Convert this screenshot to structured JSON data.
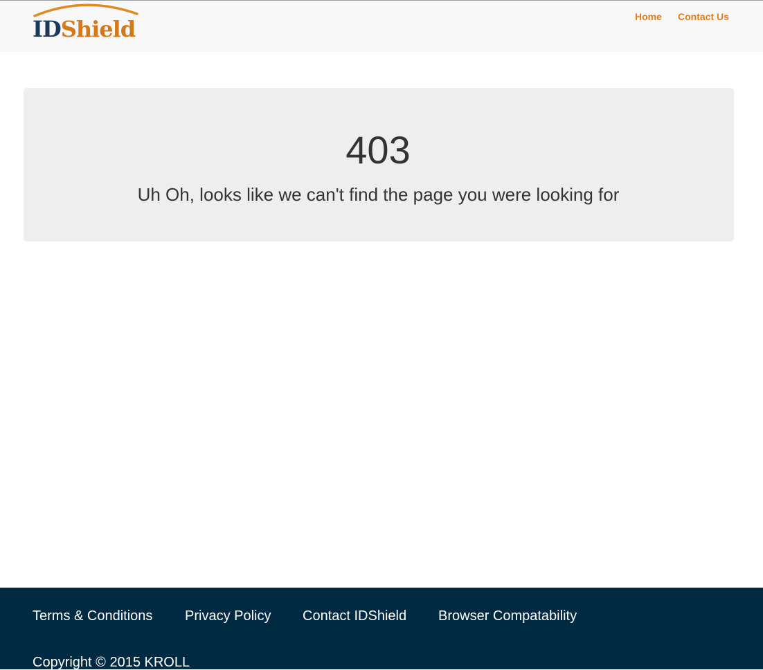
{
  "header": {
    "logo": {
      "prefix": "ID",
      "suffix": "Shield",
      "prefix_color": "#1b3a5a",
      "suffix_color": "#d4781c"
    },
    "nav": [
      {
        "label": "Home"
      },
      {
        "label": "Contact Us"
      }
    ],
    "accent_color": "#e07b20"
  },
  "main": {
    "error_code": "403",
    "message": "Uh Oh, looks like we can't find the page you were looking for"
  },
  "footer": {
    "background": "#002942",
    "links": [
      {
        "label": "Terms & Conditions"
      },
      {
        "label": "Privacy Policy"
      },
      {
        "label": "Contact IDShield"
      },
      {
        "label": "Browser Compatability"
      }
    ],
    "copyright": "Copyright © 2015 KROLL"
  }
}
